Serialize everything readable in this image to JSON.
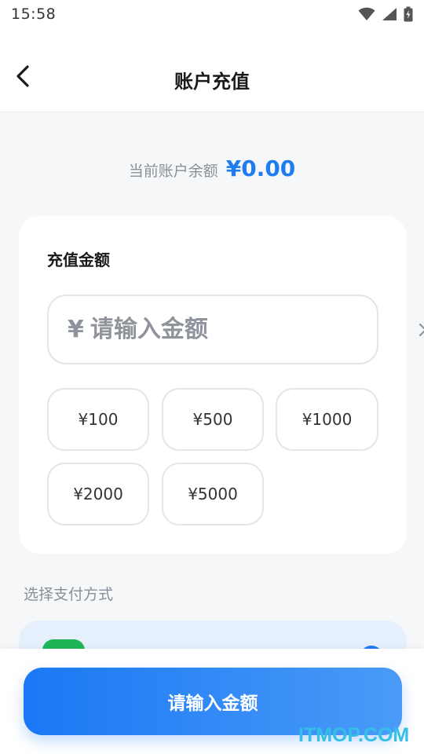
{
  "status_bar": {
    "time": "15:58",
    "icons": [
      "wifi-icon",
      "signal-icon",
      "battery-icon"
    ]
  },
  "header": {
    "back_icon": "chevron-left-icon",
    "title": "账户充值"
  },
  "balance": {
    "label": "当前账户余额",
    "value": "¥0.00",
    "color": "#1c7cf0"
  },
  "amount_card": {
    "title": "充值金额",
    "input": {
      "currency": "¥",
      "value": "",
      "placeholder": "请输入金额",
      "clear_icon": "close-icon"
    },
    "presets": [
      "¥100",
      "¥500",
      "¥1000",
      "¥2000",
      "¥5000"
    ]
  },
  "payment": {
    "label": "选择支付方式",
    "method_icon": "wechat-pay-icon",
    "icon_color": "#1fb657"
  },
  "submit": {
    "label": "请输入金额"
  },
  "watermark": "ITMOP.COM"
}
